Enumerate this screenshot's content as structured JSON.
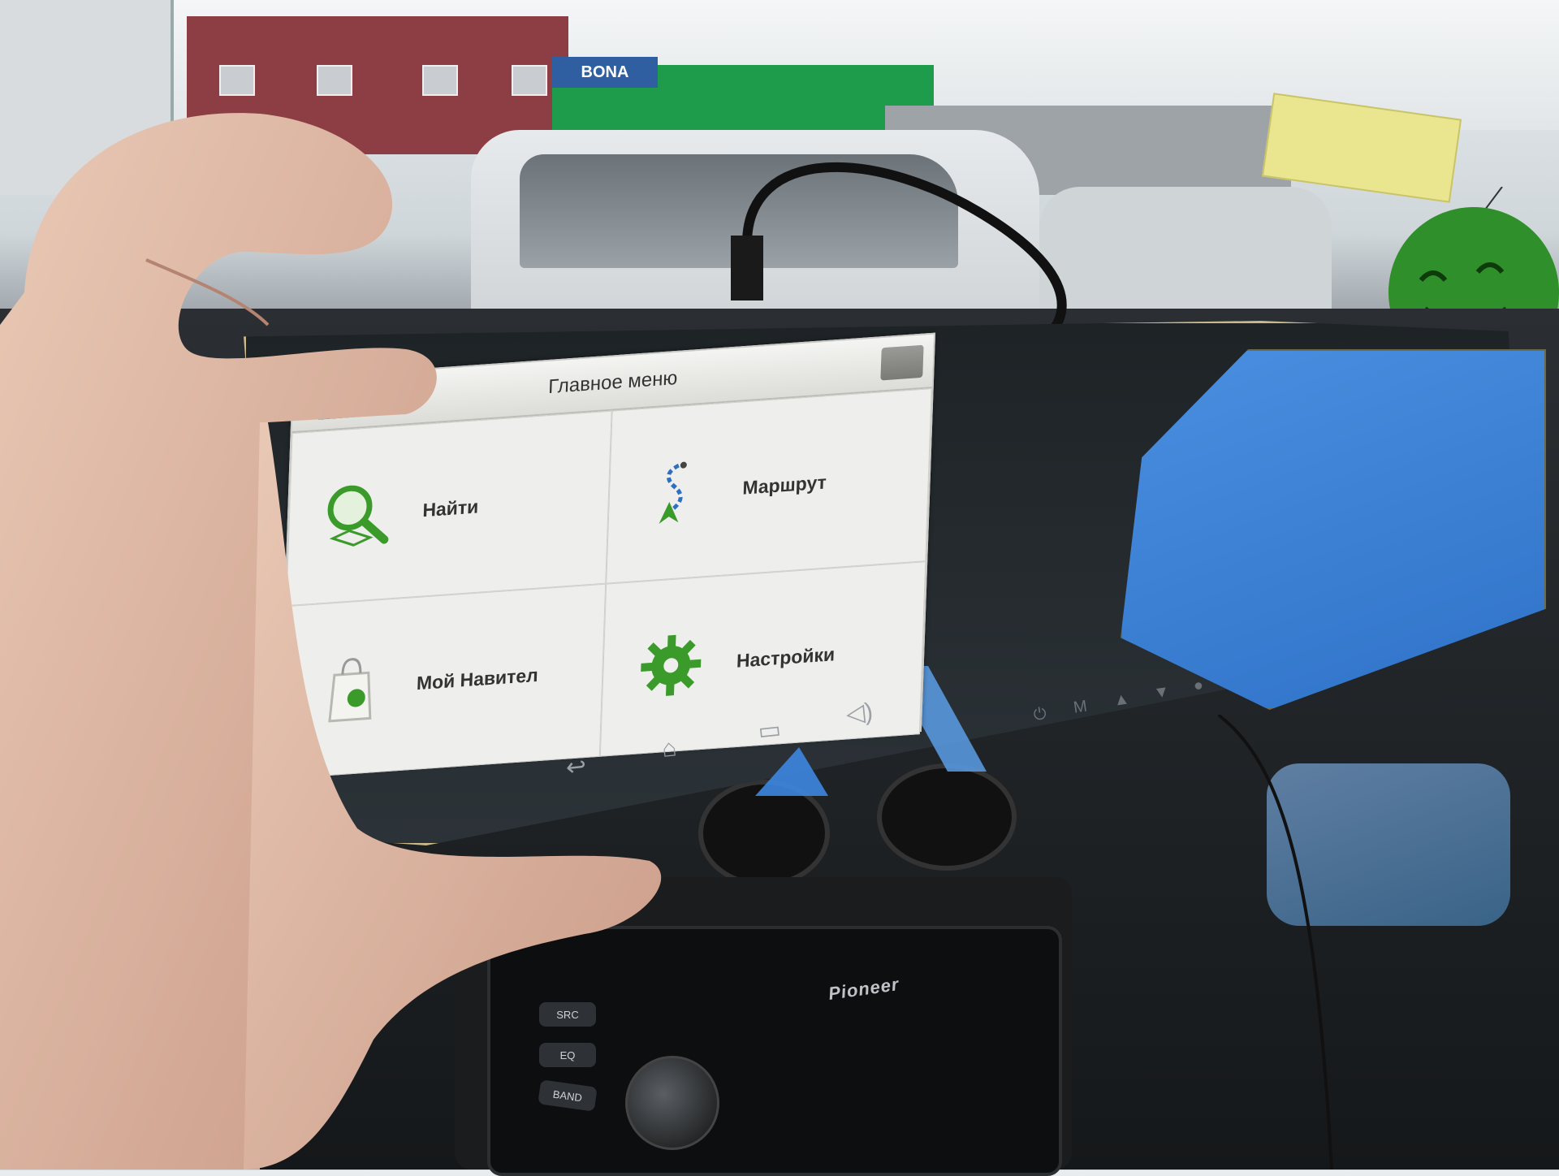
{
  "scene": {
    "store_sign": "BONA",
    "radio_brand": "Pioneer",
    "radio_buttons": [
      "SRC",
      "EQ",
      "BAND"
    ]
  },
  "navitel": {
    "title": "Главное меню",
    "tiles": [
      {
        "label": "Найти",
        "icon": "search-magnifier-icon"
      },
      {
        "label": "Маршрут",
        "icon": "route-arrow-icon"
      },
      {
        "label": "Мой Навител",
        "icon": "shopping-bag-icon"
      },
      {
        "label": "Настройки",
        "icon": "gear-icon"
      }
    ]
  },
  "android_nav": [
    "back-icon",
    "home-icon",
    "recent-apps-icon",
    "volume-icon"
  ],
  "colors": {
    "accent_green": "#3a9a2a",
    "mirror_blue": "#3a86dc",
    "bezel_gold": "#c8b88a"
  }
}
